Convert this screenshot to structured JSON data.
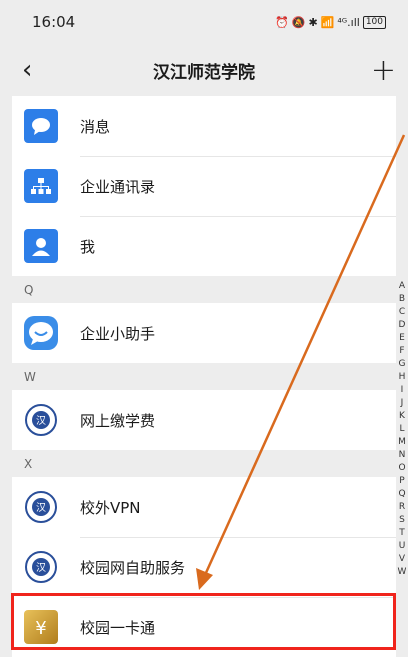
{
  "status_bar": {
    "time": "16:04",
    "signal_text": "⁴ᴳ.ıll",
    "battery_level": "100"
  },
  "nav": {
    "title": "汉江师范学院",
    "back_glyph": "‹",
    "add_glyph": "+"
  },
  "items": {
    "messages": "消息",
    "directory": "企业通讯录",
    "me": "我",
    "assistant": "企业小助手",
    "tuition": "网上缴学费",
    "vpn": "校外VPN",
    "selfservice": "校园网自助服务",
    "campus_card": "校园一卡通"
  },
  "sections": {
    "q": "Q",
    "w": "W",
    "x": "X"
  },
  "index_letters": [
    "A",
    "B",
    "C",
    "D",
    "E",
    "F",
    "G",
    "H",
    "I",
    "J",
    "K",
    "L",
    "M",
    "N",
    "O",
    "P",
    "Q",
    "R",
    "S",
    "T",
    "U",
    "V",
    "W"
  ],
  "colors": {
    "accent_blue": "#2d7ee8",
    "highlight_red": "#f0241c",
    "arrow_orange": "#d96a1e"
  }
}
